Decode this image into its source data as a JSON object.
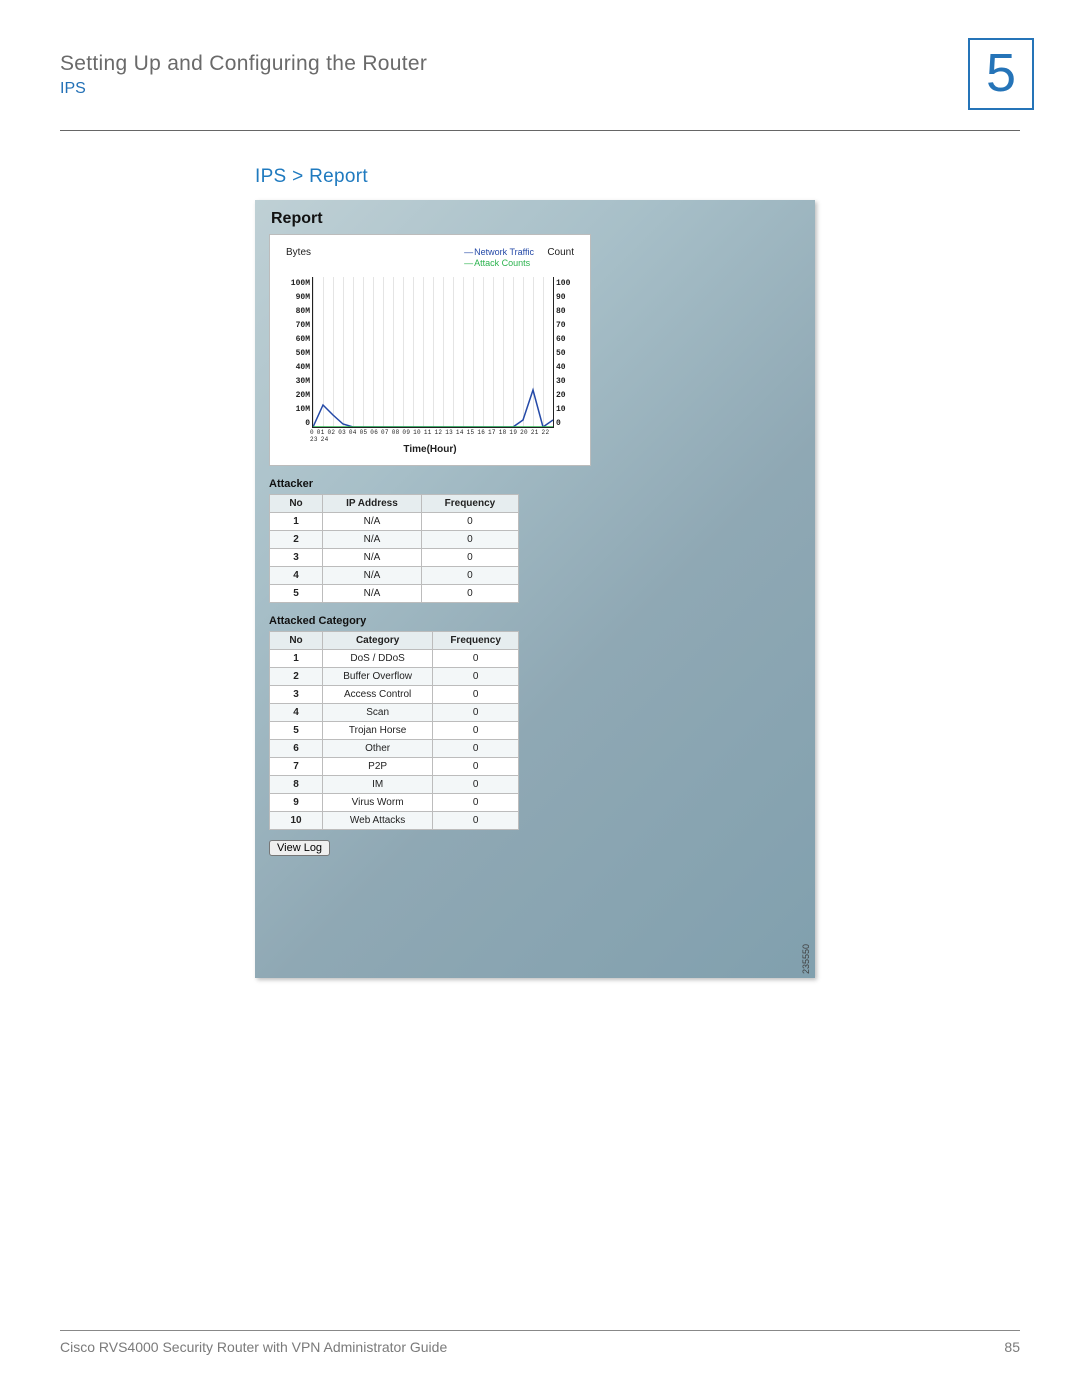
{
  "header": {
    "chapter_title": "Setting Up and Configuring the Router",
    "chapter_sub": "IPS",
    "chapter_number": "5"
  },
  "section": {
    "heading": "IPS > Report"
  },
  "panel": {
    "title": "Report",
    "legend": {
      "line1": "Network Traffic",
      "line2": "Attack Counts"
    },
    "axis_left_label": "Bytes",
    "axis_right_label": "Count",
    "x_title": "Time(Hour)",
    "y_left_ticks": [
      "100M",
      "90M",
      "80M",
      "70M",
      "60M",
      "50M",
      "40M",
      "30M",
      "20M",
      "10M",
      "0"
    ],
    "y_right_ticks": [
      "100",
      "90",
      "80",
      "70",
      "60",
      "50",
      "40",
      "30",
      "20",
      "10",
      "0"
    ],
    "x_ticks_text": "0 01 02 03 04 05 06 07 08 09 10 11 12 13 14 15 16 17 18 19 20 21 22 23 24",
    "attacker": {
      "title": "Attacker",
      "headers": [
        "No",
        "IP Address",
        "Frequency"
      ],
      "rows": [
        {
          "no": "1",
          "ip": "N/A",
          "freq": "0"
        },
        {
          "no": "2",
          "ip": "N/A",
          "freq": "0"
        },
        {
          "no": "3",
          "ip": "N/A",
          "freq": "0"
        },
        {
          "no": "4",
          "ip": "N/A",
          "freq": "0"
        },
        {
          "no": "5",
          "ip": "N/A",
          "freq": "0"
        }
      ]
    },
    "attacked": {
      "title": "Attacked Category",
      "headers": [
        "No",
        "Category",
        "Frequency"
      ],
      "rows": [
        {
          "no": "1",
          "cat": "DoS / DDoS",
          "freq": "0"
        },
        {
          "no": "2",
          "cat": "Buffer Overflow",
          "freq": "0"
        },
        {
          "no": "3",
          "cat": "Access Control",
          "freq": "0"
        },
        {
          "no": "4",
          "cat": "Scan",
          "freq": "0"
        },
        {
          "no": "5",
          "cat": "Trojan Horse",
          "freq": "0"
        },
        {
          "no": "6",
          "cat": "Other",
          "freq": "0"
        },
        {
          "no": "7",
          "cat": "P2P",
          "freq": "0"
        },
        {
          "no": "8",
          "cat": "IM",
          "freq": "0"
        },
        {
          "no": "9",
          "cat": "Virus Worm",
          "freq": "0"
        },
        {
          "no": "10",
          "cat": "Web Attacks",
          "freq": "0"
        }
      ]
    },
    "view_log_label": "View Log",
    "figure_number": "235550"
  },
  "footer": {
    "guide": "Cisco RVS4000 Security Router with VPN Administrator Guide",
    "page": "85"
  },
  "chart_data": {
    "type": "line",
    "title": "Report",
    "xlabel": "Time(Hour)",
    "x": [
      0,
      1,
      2,
      3,
      4,
      5,
      6,
      7,
      8,
      9,
      10,
      11,
      12,
      13,
      14,
      15,
      16,
      17,
      18,
      19,
      20,
      21,
      22,
      23,
      24
    ],
    "series": [
      {
        "name": "Network Traffic",
        "y_axis": "left",
        "y_unit": "Bytes",
        "ylim": [
          0,
          100000000
        ],
        "values": [
          0,
          15000000,
          8000000,
          2000000,
          0,
          0,
          0,
          0,
          0,
          0,
          0,
          0,
          0,
          0,
          0,
          0,
          0,
          0,
          0,
          0,
          0,
          5000000,
          25000000,
          0,
          5000000
        ]
      },
      {
        "name": "Attack Counts",
        "y_axis": "right",
        "y_unit": "Count",
        "ylim": [
          0,
          100
        ],
        "values": [
          0,
          0,
          0,
          0,
          0,
          0,
          0,
          0,
          0,
          0,
          0,
          0,
          0,
          0,
          0,
          0,
          0,
          0,
          0,
          0,
          0,
          0,
          0,
          0,
          0
        ]
      }
    ],
    "legend_position": "top-right"
  }
}
